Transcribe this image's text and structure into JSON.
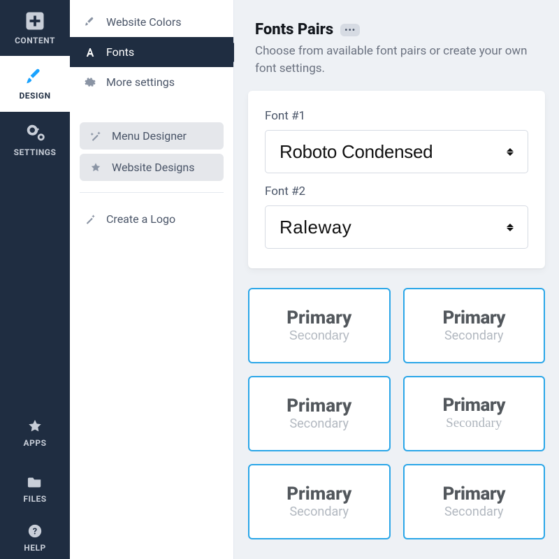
{
  "sidebar": {
    "top": [
      {
        "id": "content",
        "label": "CONTENT"
      },
      {
        "id": "design",
        "label": "DESIGN"
      },
      {
        "id": "settings",
        "label": "SETTINGS"
      }
    ],
    "bottom": [
      {
        "id": "apps",
        "label": "APPS"
      },
      {
        "id": "files",
        "label": "FILES"
      },
      {
        "id": "help",
        "label": "HELP"
      }
    ]
  },
  "submenu": {
    "items": [
      {
        "id": "website-colors",
        "label": "Website Colors"
      },
      {
        "id": "fonts",
        "label": "Fonts"
      },
      {
        "id": "more-settings",
        "label": "More settings"
      },
      {
        "id": "menu-designer",
        "label": "Menu Designer"
      },
      {
        "id": "website-designs",
        "label": "Website Designs"
      },
      {
        "id": "create-logo",
        "label": "Create a Logo"
      }
    ]
  },
  "main": {
    "title": "Fonts Pairs",
    "badge": "•••",
    "description": "Choose from available font pairs or create your own font settings.",
    "font1_label": "Font #1",
    "font1_value": "Roboto Condensed",
    "font2_label": "Font #2",
    "font2_value": "Raleway",
    "pair_text": {
      "primary": "Primary",
      "secondary": "Secondary"
    },
    "pairs": [
      "a",
      "b",
      "c",
      "d",
      "e",
      "f"
    ]
  }
}
